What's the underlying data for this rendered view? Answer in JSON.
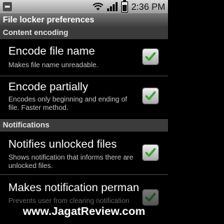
{
  "status_bar": {
    "time": "2:36 PM",
    "icons": [
      "notification-icon",
      "wifi-icon",
      "signal-icon",
      "battery-icon"
    ]
  },
  "title_bar": {
    "title": "File locker preferences"
  },
  "sections": {
    "content_encoding": {
      "header": "Content encoding",
      "encode_file_name": {
        "title": "Encode file name",
        "summary": "Makes file name unreadable.",
        "checked": true
      },
      "encode_partially": {
        "title": "Encode partially",
        "summary": "Encodes only beginning and ending of file. Faster method.",
        "checked": true
      }
    },
    "notifications": {
      "header": "Notifications",
      "notifies_unlocked": {
        "title": "Notifies unlocked files",
        "summary": "Shows notification that informs there are unlocked files.",
        "checked": true
      },
      "makes_permanent": {
        "title": "Makes notification perman",
        "summary": "Prevents user from clearing notification",
        "checked": true
      }
    }
  },
  "watermark": {
    "text": "www.JagatReview.com"
  },
  "colors": {
    "section_bg": "#3b3b3b",
    "title_bar": "#5a5a5a",
    "check_green": "#3aa535"
  }
}
